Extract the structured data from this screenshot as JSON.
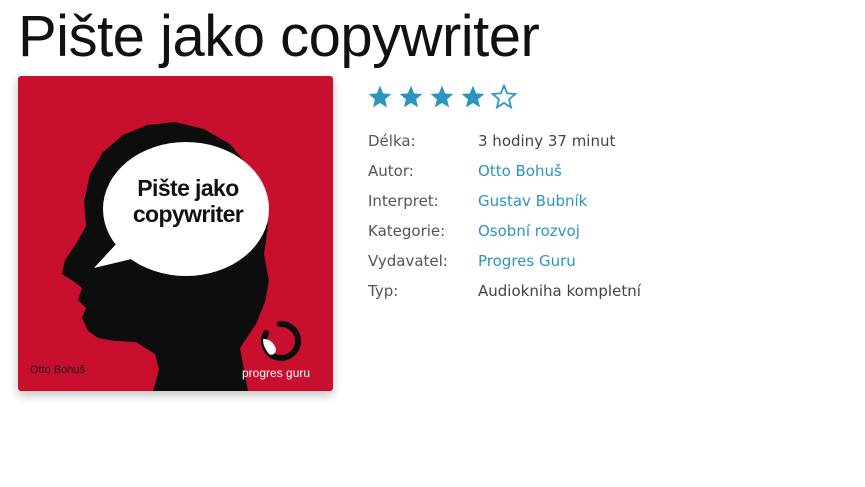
{
  "title": "Pište jako copywriter",
  "cover": {
    "bubble_line1": "Pište jako",
    "bubble_line2": "copywriter",
    "author": "Otto Bohuš",
    "publisher": "progres guru",
    "background_color": "#c8102e"
  },
  "rating": {
    "value": 4,
    "max": 5,
    "star_color": "#2a95bf"
  },
  "details": [
    {
      "label": "Délka:",
      "value": "3 hodiny 37 minut",
      "is_link": false
    },
    {
      "label": "Autor:",
      "value": "Otto Bohuš",
      "is_link": true
    },
    {
      "label": "Interpret:",
      "value": "Gustav Bubník",
      "is_link": true
    },
    {
      "label": "Kategorie:",
      "value": "Osobní rozvoj",
      "is_link": true
    },
    {
      "label": "Vydavatel:",
      "value": "Progres Guru",
      "is_link": true
    },
    {
      "label": "Typ:",
      "value": "Audiokniha kompletní",
      "is_link": false
    }
  ]
}
